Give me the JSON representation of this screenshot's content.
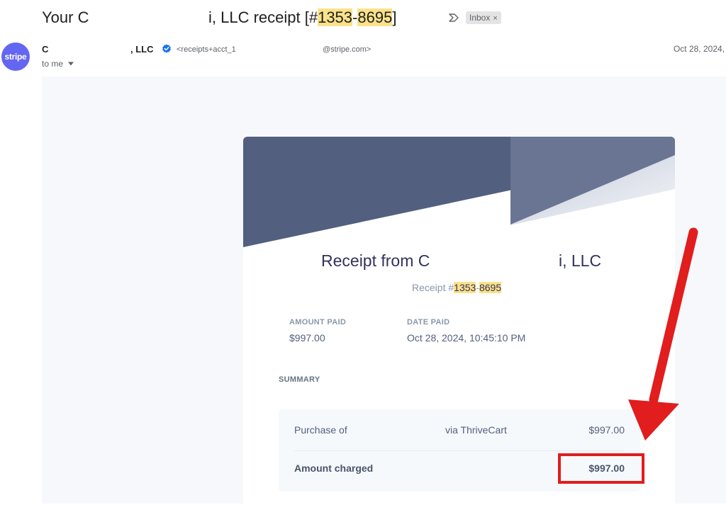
{
  "subject": {
    "part1": "Your C",
    "part2": "i, LLC receipt [#",
    "num1": "1353",
    "dash": "-",
    "num2": "8695",
    "close": "]",
    "label": "Inbox",
    "label_close": "×"
  },
  "sender": {
    "avatar_text": "stripe",
    "name_part1": "C",
    "name_part2": ", LLC",
    "email_part1": "<receipts+acct_1",
    "email_part2": "@stripe.com>",
    "date": "Oct 28, 2024,",
    "to": "to me"
  },
  "receipt": {
    "title_part1": "Receipt from C",
    "title_part2": "i, LLC",
    "number_prefix": "Receipt #",
    "num1": "1353",
    "dash": "-",
    "num2": "8695",
    "amount_paid_label": "AMOUNT PAID",
    "amount_paid_value": "$997.00",
    "date_paid_label": "DATE PAID",
    "date_paid_value": "Oct 28, 2024, 10:45:10 PM",
    "summary_label": "SUMMARY",
    "line_item": {
      "label": "Purchase of",
      "via": "via ThriveCart",
      "amount": "$997.00"
    },
    "charged": {
      "label": "Amount charged",
      "amount": "$997.00"
    }
  },
  "colors": {
    "banner": "#525f7f",
    "avatar": "#6366f1",
    "highlight": "#fbe28a",
    "annotation": "#e11d1d"
  }
}
